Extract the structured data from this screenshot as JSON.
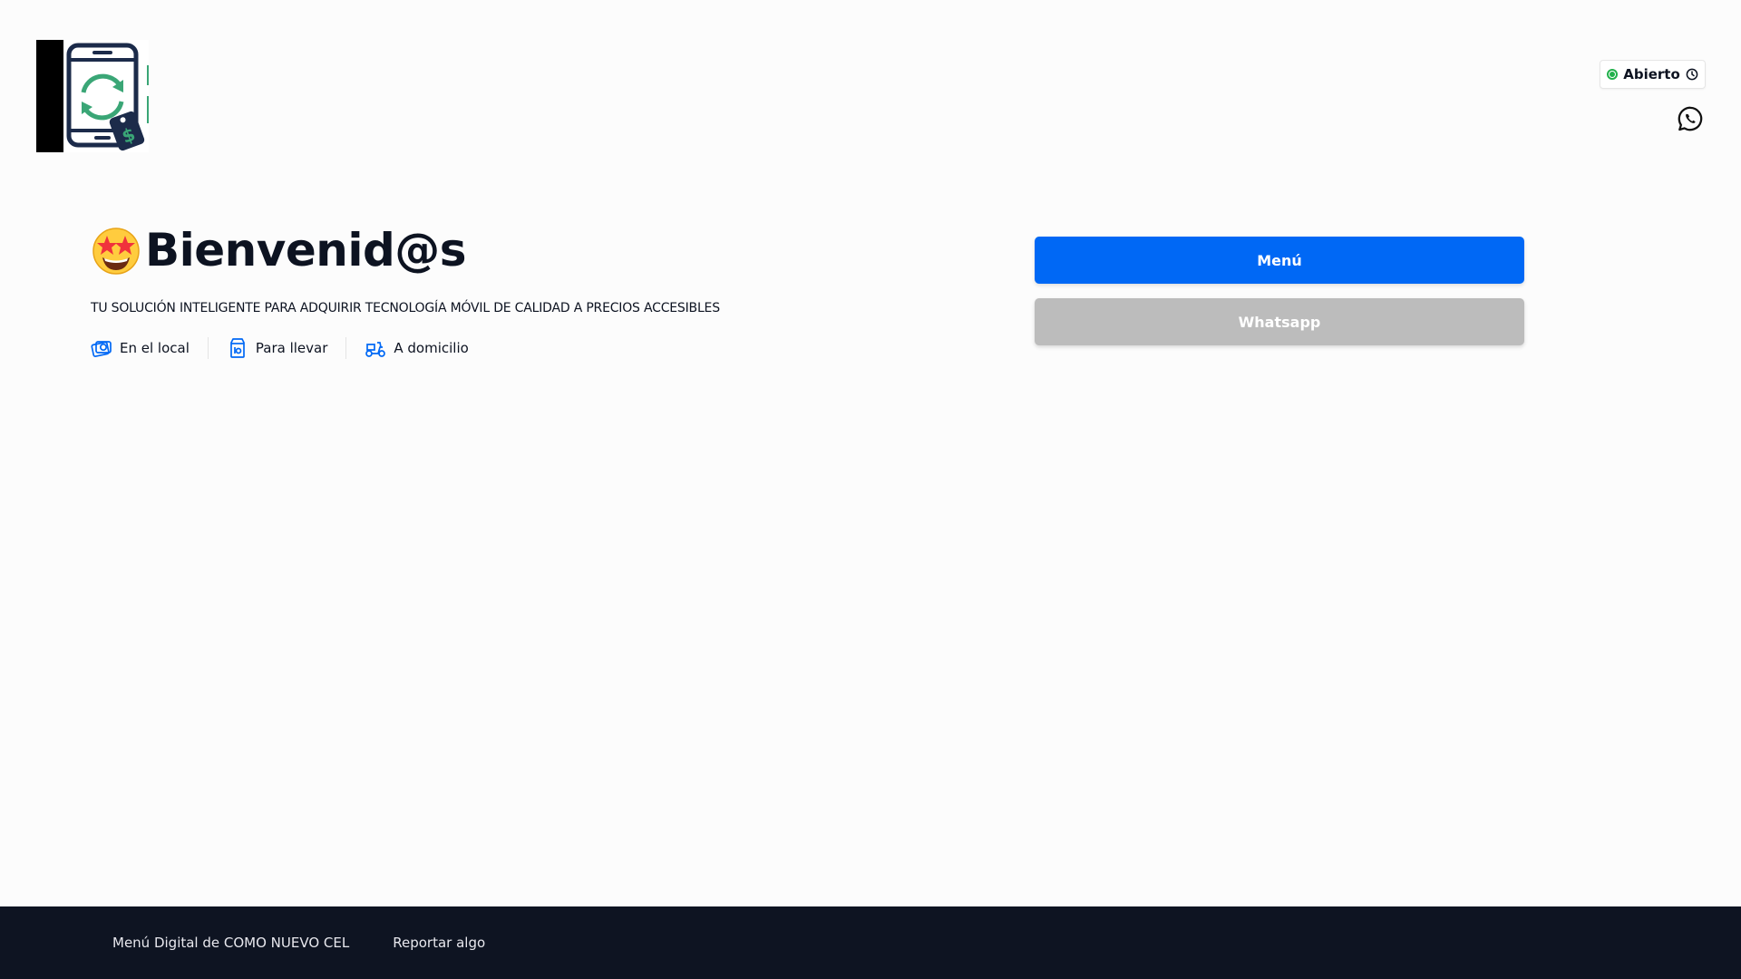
{
  "header": {
    "status_label": "Abierto",
    "status_color": "#22b14c",
    "logo_icon": "phone-refresh-price-tag-logo",
    "whatsapp_icon": "whatsapp-icon"
  },
  "hero": {
    "title": "Bienvenid@s",
    "emoji_icon": "star-struck-emoji-icon",
    "subtitle": "TU SOLUCIÓN INTELIGENTE PARA ADQUIRIR TECNOLOGÍA MÓVIL DE CALIDAD A PRECIOS ACCESIBLES",
    "services": [
      {
        "label": "En el local",
        "icon": "dine-in-icon"
      },
      {
        "label": "Para llevar",
        "icon": "takeaway-bag-icon"
      },
      {
        "label": "A domicilio",
        "icon": "delivery-scooter-icon"
      }
    ]
  },
  "actions": {
    "menu_label": "Menú",
    "whatsapp_label": "Whatsapp",
    "menu_color": "#0068f5",
    "whatsapp_color": "#bcbcbc"
  },
  "footer": {
    "links": [
      "Menú Digital de COMO NUEVO CEL",
      "Reportar algo"
    ]
  }
}
